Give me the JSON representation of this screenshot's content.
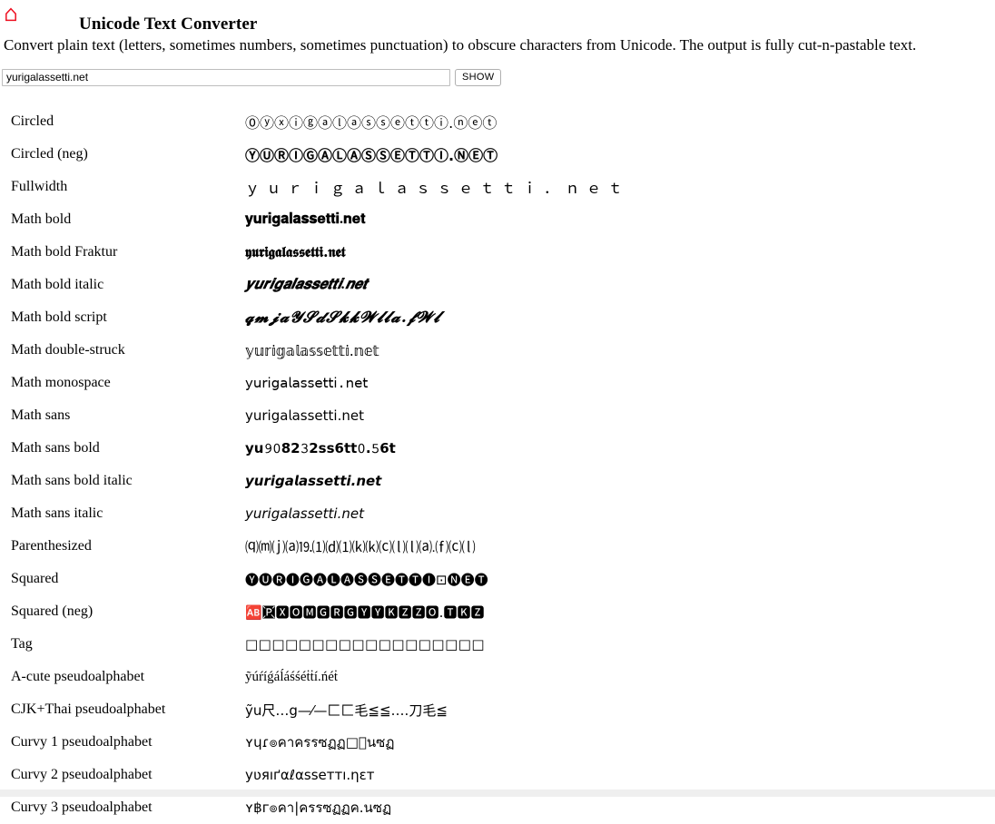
{
  "header": {
    "home_icon": "home-icon",
    "title": "Unicode Text Converter"
  },
  "intro": "Convert plain text (letters, sometimes numbers, sometimes punctuation) to obscure characters from Unicode. The output is fully cut-n-pastable text.",
  "form": {
    "input_value": "yurigalassetti.net",
    "input_placeholder": "",
    "show_label": "SHOW"
  },
  "results": {
    "rows": [
      {
        "label": "Circled",
        "output": "⓪ⓨⓧⓘⓖⓐⓛⓐⓢⓢⓔⓣⓣⓘ․ⓝⓔⓣ",
        "style": "o-circled"
      },
      {
        "label": "Circled (neg)",
        "output": "ⓎⓊⓇⒾⒼⒶⓁⒶⓈⓈⒺⓉⓉⒾ.ⓃⒺⓉ",
        "style": "o-circled-neg"
      },
      {
        "label": "Fullwidth",
        "output": "ｙｕｒｉｇａｌａｓｓｅｔｔｉ．ｎｅｔ",
        "style": "o-fullwidth"
      },
      {
        "label": "Math bold",
        "output": "𝐲𝐮𝐫𝐢𝐠𝐚𝐥𝐚𝐬𝐬𝐞𝐭𝐭𝐢.𝐧𝐞𝐭",
        "style": "o-mbold"
      },
      {
        "label": "Math bold Fraktur",
        "output": "𝖞𝖚𝖗𝖎𝖌𝖆𝖑𝖆𝖘𝖘𝖊𝖙𝖙𝖎.𝖓𝖊𝖙",
        "style": "o-mfraktur"
      },
      {
        "label": "Math bold italic",
        "output": "𝒚𝒖𝒓𝒊𝒈𝒂𝒍𝒂𝒔𝒔𝒆𝒕𝒕𝒊.𝒏𝒆𝒕",
        "style": "o-mbolditalic"
      },
      {
        "label": "Math bold script",
        "output": "𝓺𝓶𝓳𝓪𝓨𝓢𝓭𝓢𝓴𝓴𝓦𝓵𝓵𝓪.𝓯𝓦𝓵",
        "style": "o-mboldscript"
      },
      {
        "label": "Math double-struck",
        "output": "𝕪𝕦𝕣𝕚𝕘𝕒𝕝𝕒𝕤𝕤𝕖𝕥𝕥𝕚.𝕟𝕖𝕥",
        "style": "o-dstruck"
      },
      {
        "label": "Math monospace",
        "output": "𝗒𝗎𝗋𝗂𝗀𝖺𝗅𝖺𝗌𝗌𝖾𝗍𝗍𝗂.𝗇𝖾𝗍",
        "style": "o-mono"
      },
      {
        "label": "Math sans",
        "output": "𝗒𝗎𝗋𝗂𝗀𝖺𝗅𝖺𝗌𝗌𝖾𝗍𝗍𝗂.𝗇𝖾𝗍",
        "style": "o-sans"
      },
      {
        "label": "Math sans bold",
        "output": "𝘆𝘂𝟿𝟶𝟴𝟮𝟹𝟮𝘀𝘀𝟲𝘁𝘁𝟶.𝟻𝟲𝘁",
        "style": "o-sansbold"
      },
      {
        "label": "Math sans bold italic",
        "output": "𝙮𝙪𝙧𝙞𝙜𝙖𝙡𝙖𝙨𝙨𝙚𝙩𝙩𝙞.𝙣𝙚𝙩",
        "style": "o-sansbolditalic"
      },
      {
        "label": "Math sans italic",
        "output": "𝘺𝘶𝘳𝘪𝘨𝘢𝘭𝘢𝘴𝘴𝘦𝘵𝘵𝘪.𝘯𝘦𝘵",
        "style": "o-sansitalic"
      },
      {
        "label": "Parenthesized",
        "output": "⒬⒨⒥⒜⒚⑴⒟⑴⒦⒦⒞⒧⒧⒜.⒡⒞⒧",
        "style": "o-paren"
      },
      {
        "label": "Squared",
        "output": "🅨🅤🅡🅘🅖🅐🅛🅐🅢🅢🅔🅣🅣🅘⊡🅝🅔🅣",
        "style": "o-squared"
      },
      {
        "label": "Squared (neg)",
        "output": "🆎🆊🆇🅾🅼🅶🆁🅶🆈🆈🅺🆉🆉🅾.🆃🅺🆉",
        "style": "o-squared-neg"
      },
      {
        "label": "Tag",
        "output": "□□□□□□□□□□□□□□□□□□",
        "style": "o-tag"
      },
      {
        "label": "A-cute pseudoalphabet",
        "output": "ỹúŕíǵáĺáśśéṫṫí.ńéṫ",
        "style": "o-acute"
      },
      {
        "label": "CJK+Thai pseudoalphabet",
        "output": "ỹu尺…g—⁄—匚匚毛≦≦….刀毛≦",
        "style": "o-cjkthai"
      },
      {
        "label": "Curvy 1 pseudoalphabet",
        "output": "ʏɥɾ๏คาครรซฏฏ□ินซฏ",
        "style": "o-curvy1"
      },
      {
        "label": "Curvy 2 pseudoalphabet",
        "output": "yʋяıґαℓαsseттı.ηεт",
        "style": "o-curvy2"
      },
      {
        "label": "Curvy 3 pseudoalphabet",
        "output": "ʏ฿г๏คา|ครรซฏฏค.นซฏ",
        "style": "o-curvy3"
      }
    ]
  },
  "colors": {
    "home_icon": "#ee1122",
    "text": "#000000",
    "background": "#ffffff",
    "input_border": "#bdbdbd",
    "button_border": "#b0b0b0",
    "bottom_strip": "#efefef"
  }
}
